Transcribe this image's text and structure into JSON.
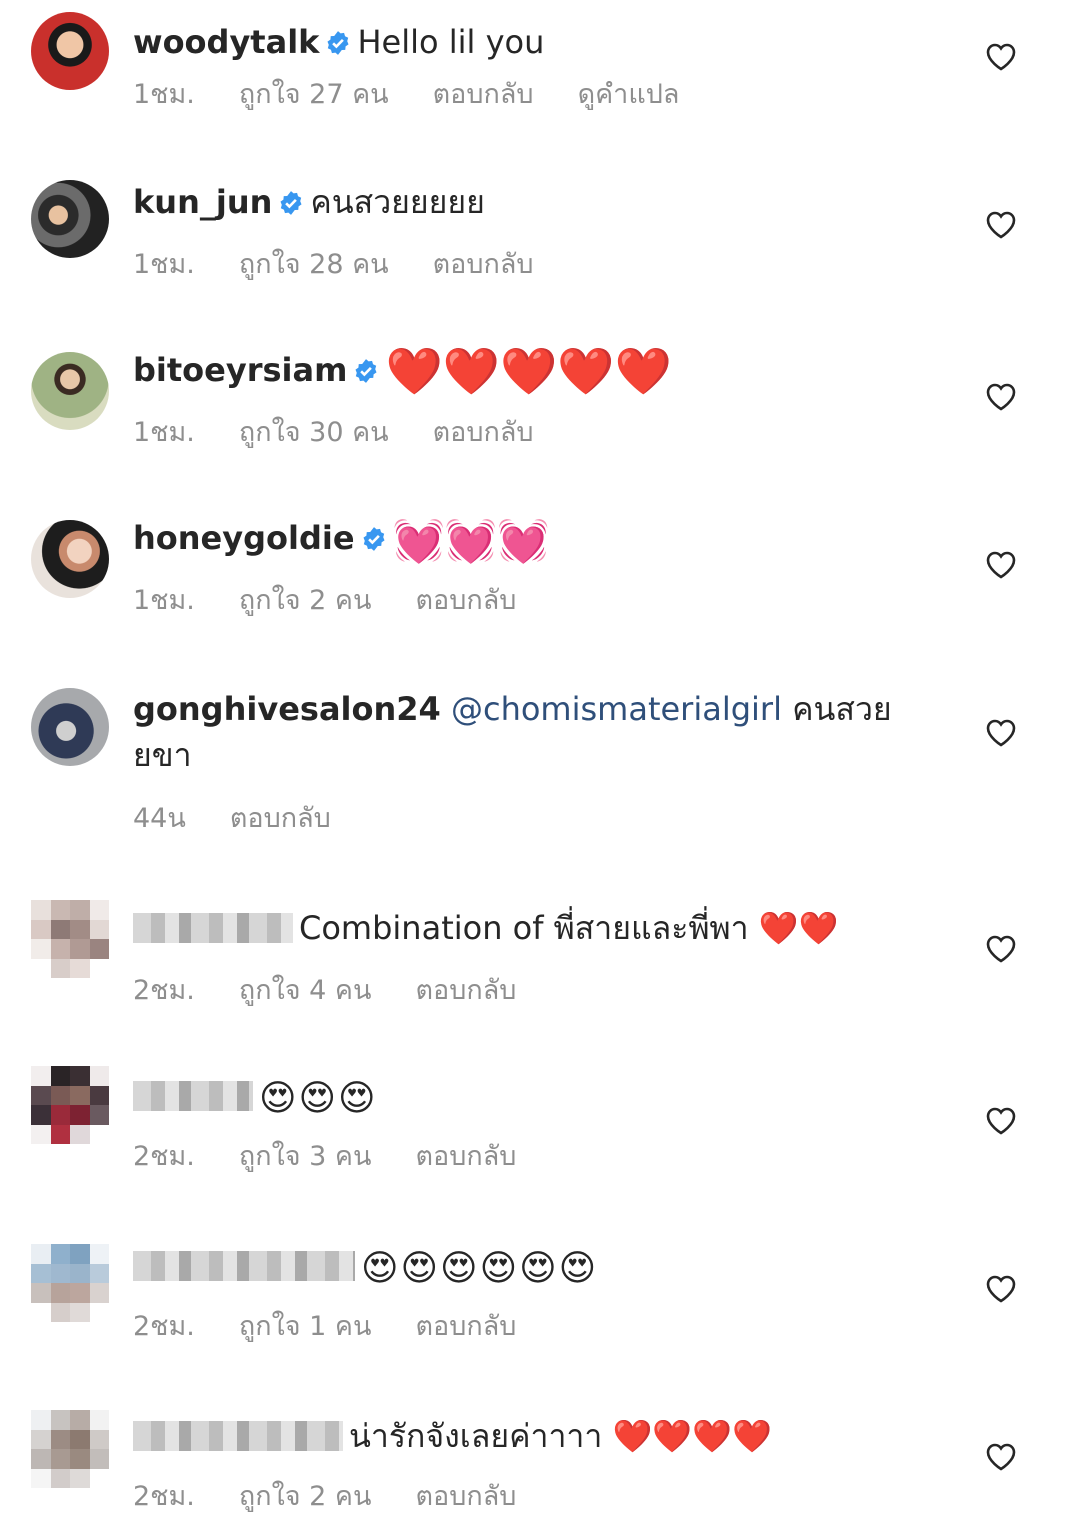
{
  "comments": [
    {
      "username": "woodytalk",
      "verified": true,
      "text": "Hello lil you",
      "time": "1ชม.",
      "likes": "ถูกใจ 27 คน",
      "reply": "ตอบกลับ",
      "translate": "ดูคำแปล"
    },
    {
      "username": "kun_jun",
      "verified": true,
      "text": "คนสวยยยยย",
      "time": "1ชม.",
      "likes": "ถูกใจ 28 คน",
      "reply": "ตอบกลับ"
    },
    {
      "username": "bitoeyrsiam",
      "verified": true,
      "text": "❤️❤️❤️❤️❤️",
      "time": "1ชม.",
      "likes": "ถูกใจ 30 คน",
      "reply": "ตอบกลับ"
    },
    {
      "username": "honeygoldie",
      "verified": true,
      "text": "💓💓💓",
      "time": "1ชม.",
      "likes": "ถูกใจ 2 คน",
      "reply": "ตอบกลับ"
    },
    {
      "username": "gonghivesalon24",
      "verified": false,
      "mention": "@chomismaterialgirl",
      "text": "คนสวยยขา",
      "time": "44น",
      "reply": "ตอบกลับ"
    },
    {
      "username": "",
      "blurred": true,
      "text": "Combination of พี่สายและพี่พา ❤️❤️",
      "time": "2ชม.",
      "likes": "ถูกใจ 4 คน",
      "reply": "ตอบกลับ"
    },
    {
      "username": "",
      "blurred": true,
      "text": "😍😍😍",
      "time": "2ชม.",
      "likes": "ถูกใจ 3 คน",
      "reply": "ตอบกลับ"
    },
    {
      "username": "",
      "blurred": true,
      "text": "😍😍😍😍😍😍",
      "time": "2ชม.",
      "likes": "ถูกใจ 1 คน",
      "reply": "ตอบกลับ"
    },
    {
      "username": "",
      "blurred": true,
      "text": "น่ารักจังเลยค่าาาา ❤️❤️❤️❤️",
      "time": "2ชม.",
      "likes": "ถูกใจ 2 คน",
      "reply": "ตอบกลับ"
    }
  ],
  "icons": {
    "like": "heart-outline-icon",
    "verified": "verified-badge-icon"
  },
  "colors": {
    "text": "#262626",
    "meta": "#8e8e8e",
    "verified": "#3897f0",
    "mention": "#2f4f7a",
    "heart": "#e0142b"
  }
}
